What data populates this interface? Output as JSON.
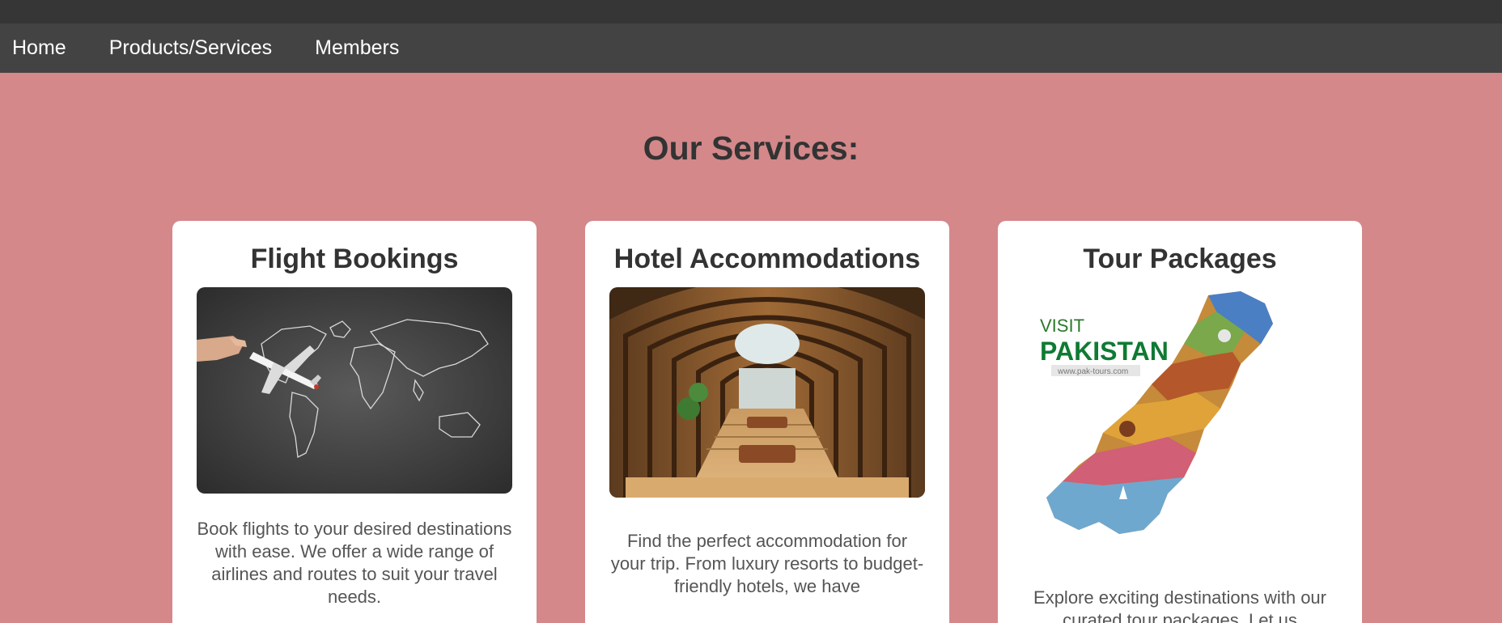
{
  "nav": {
    "items": [
      "Home",
      "Products/Services",
      "Members"
    ]
  },
  "page": {
    "title": "Our Services:"
  },
  "services": [
    {
      "title": "Flight Bookings",
      "description": "Book flights to your desired destinations with ease. We offer a wide range of airlines and routes to suit your travel needs."
    },
    {
      "title": "Hotel Accommodations",
      "description": "Find the perfect accommodation for your trip. From luxury resorts to budget-friendly hotels, we have"
    },
    {
      "title": "Tour Packages",
      "description": "Explore exciting destinations with our curated tour packages. Let us",
      "image_text": {
        "visit": "VISIT",
        "country": "PAKISTAN",
        "url": "www.pak-tours.com"
      }
    }
  ],
  "colors": {
    "background": "#d4888a",
    "navbar": "#434343",
    "topstrip": "#363636",
    "card": "#ffffff",
    "heading": "#333333"
  }
}
